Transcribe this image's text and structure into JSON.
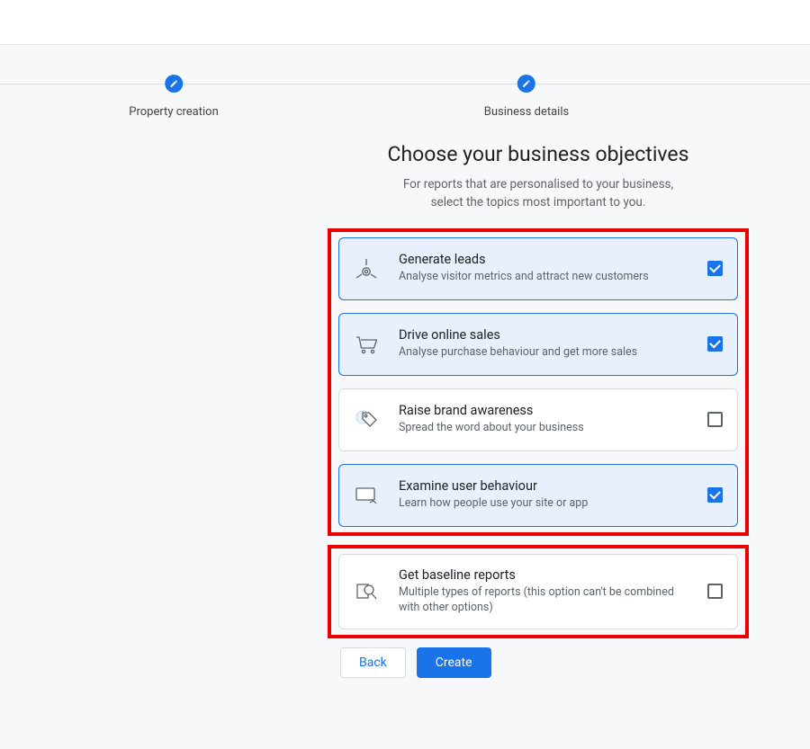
{
  "stepper": {
    "steps": [
      {
        "label": "Property creation"
      },
      {
        "label": "Business details"
      }
    ]
  },
  "page": {
    "heading": "Choose your business objectives",
    "subhead_line1": "For reports that are personalised to your business,",
    "subhead_line2": "select the topics most important to you."
  },
  "objectives": [
    {
      "title": "Generate leads",
      "desc": "Analyse visitor metrics and attract new customers",
      "selected": true
    },
    {
      "title": "Drive online sales",
      "desc": "Analyse purchase behaviour and get more sales",
      "selected": true
    },
    {
      "title": "Raise brand awareness",
      "desc": "Spread the word about your business",
      "selected": false
    },
    {
      "title": "Examine user behaviour",
      "desc": "Learn how people use your site or app",
      "selected": true
    }
  ],
  "baseline": {
    "title": "Get baseline reports",
    "desc": "Multiple types of reports (this option can't be combined with other options)",
    "selected": false
  },
  "buttons": {
    "back": "Back",
    "create": "Create"
  }
}
